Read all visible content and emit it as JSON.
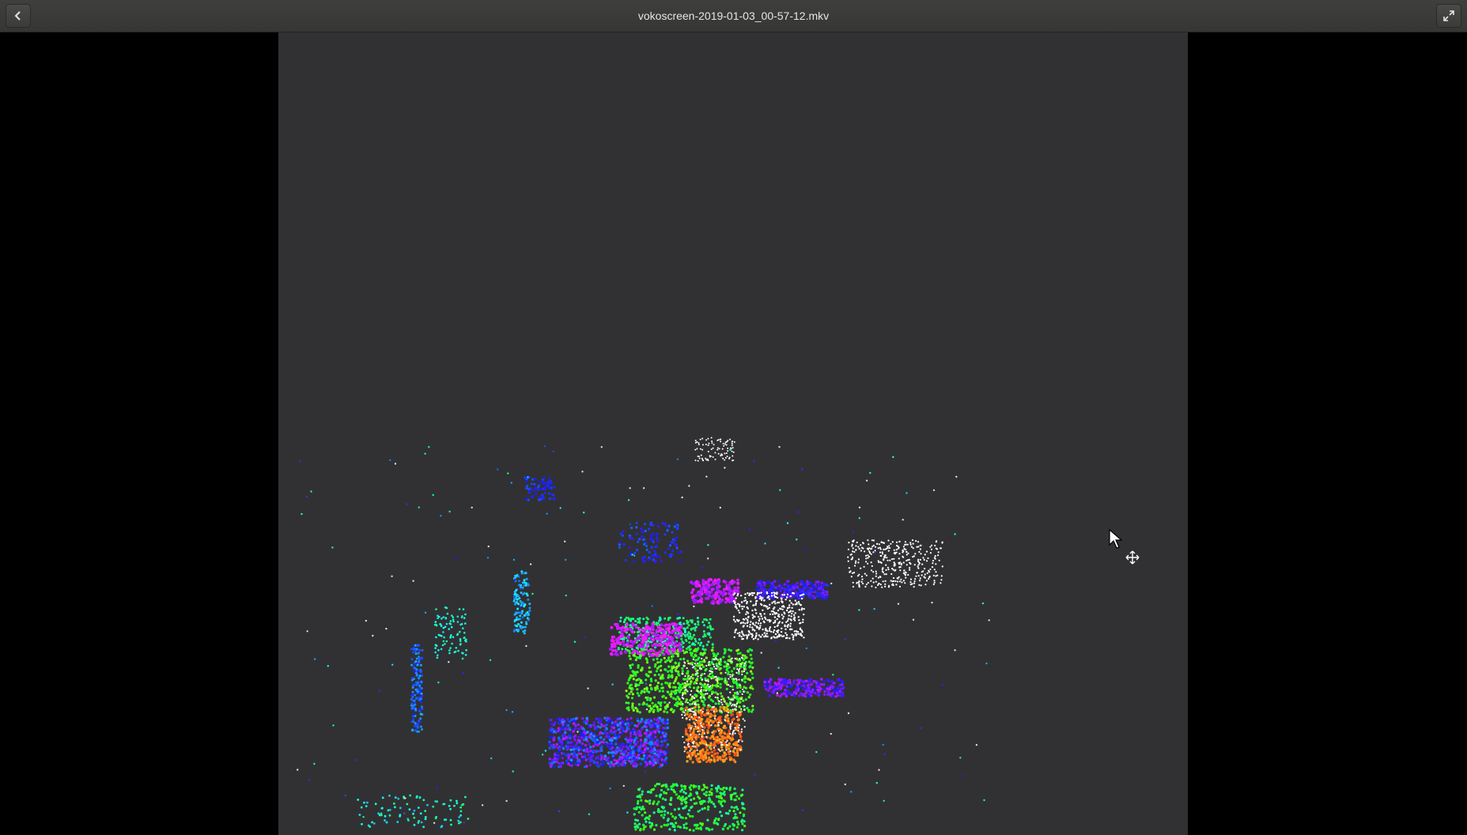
{
  "window": {
    "title": "vokoscreen-2019-01-03_00-57-12.mkv"
  },
  "icons": {
    "back": "chevron-left-icon",
    "fullscreen": "fullscreen-icon",
    "cursor": "mouse-pointer-icon",
    "move": "move-icon"
  },
  "colors": {
    "titlebar": "#3a3a38",
    "video_background": "#313133",
    "letterbox": "#000000"
  }
}
